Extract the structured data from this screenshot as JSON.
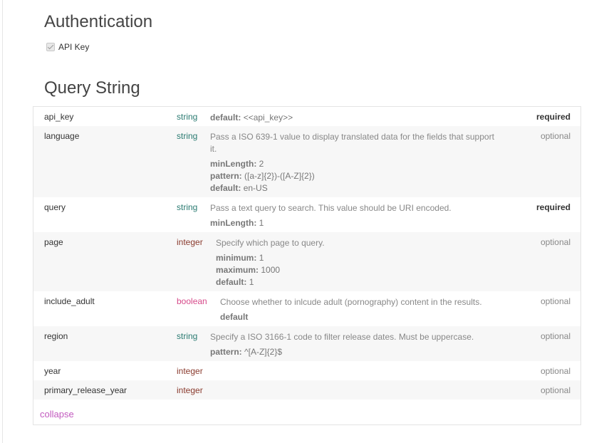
{
  "authentication": {
    "title": "Authentication",
    "api_key_label": "API Key"
  },
  "query_string": {
    "title": "Query String",
    "collapse_label": "collapse",
    "params": [
      {
        "name": "api_key",
        "type": "string",
        "required": "required",
        "description": "",
        "meta": [
          {
            "key": "default:",
            "value": "<<api_key>>"
          }
        ]
      },
      {
        "name": "language",
        "type": "string",
        "required": "optional",
        "description_line1": "Pass a ISO 639-1 value to display translated data for the fields that support",
        "description_line2": "it.",
        "meta": [
          {
            "key": "minLength:",
            "value": "2"
          },
          {
            "key": "pattern:",
            "value": "([a-z]{2})-([A-Z]{2})"
          },
          {
            "key": "default:",
            "value": "en-US"
          }
        ]
      },
      {
        "name": "query",
        "type": "string",
        "required": "required",
        "description": "Pass a text query to search. This value should be URI encoded.",
        "meta": [
          {
            "key": "minLength:",
            "value": "1"
          }
        ]
      },
      {
        "name": "page",
        "type": "integer",
        "required": "optional",
        "description": "Specify which page to query.",
        "meta": [
          {
            "key": "minimum:",
            "value": "1"
          },
          {
            "key": "maximum:",
            "value": "1000"
          },
          {
            "key": "default:",
            "value": "1"
          }
        ]
      },
      {
        "name": "include_adult",
        "type": "boolean",
        "required": "optional",
        "description": "Choose whether to inlcude adult (pornography) content in the results.",
        "meta": [
          {
            "key": "default",
            "value": ""
          }
        ]
      },
      {
        "name": "region",
        "type": "string",
        "required": "optional",
        "description": "Specify a ISO 3166-1 code to filter release dates. Must be uppercase.",
        "meta": [
          {
            "key": "pattern:",
            "value": "^[A-Z]{2}$"
          }
        ]
      },
      {
        "name": "year",
        "type": "integer",
        "required": "optional"
      },
      {
        "name": "primary_release_year",
        "type": "integer",
        "required": "optional"
      }
    ]
  },
  "colors": {
    "string_type": "#2b7b72",
    "integer_type": "#8a3b2e",
    "boolean_type": "#d64a8a",
    "link": "#c25abf"
  }
}
